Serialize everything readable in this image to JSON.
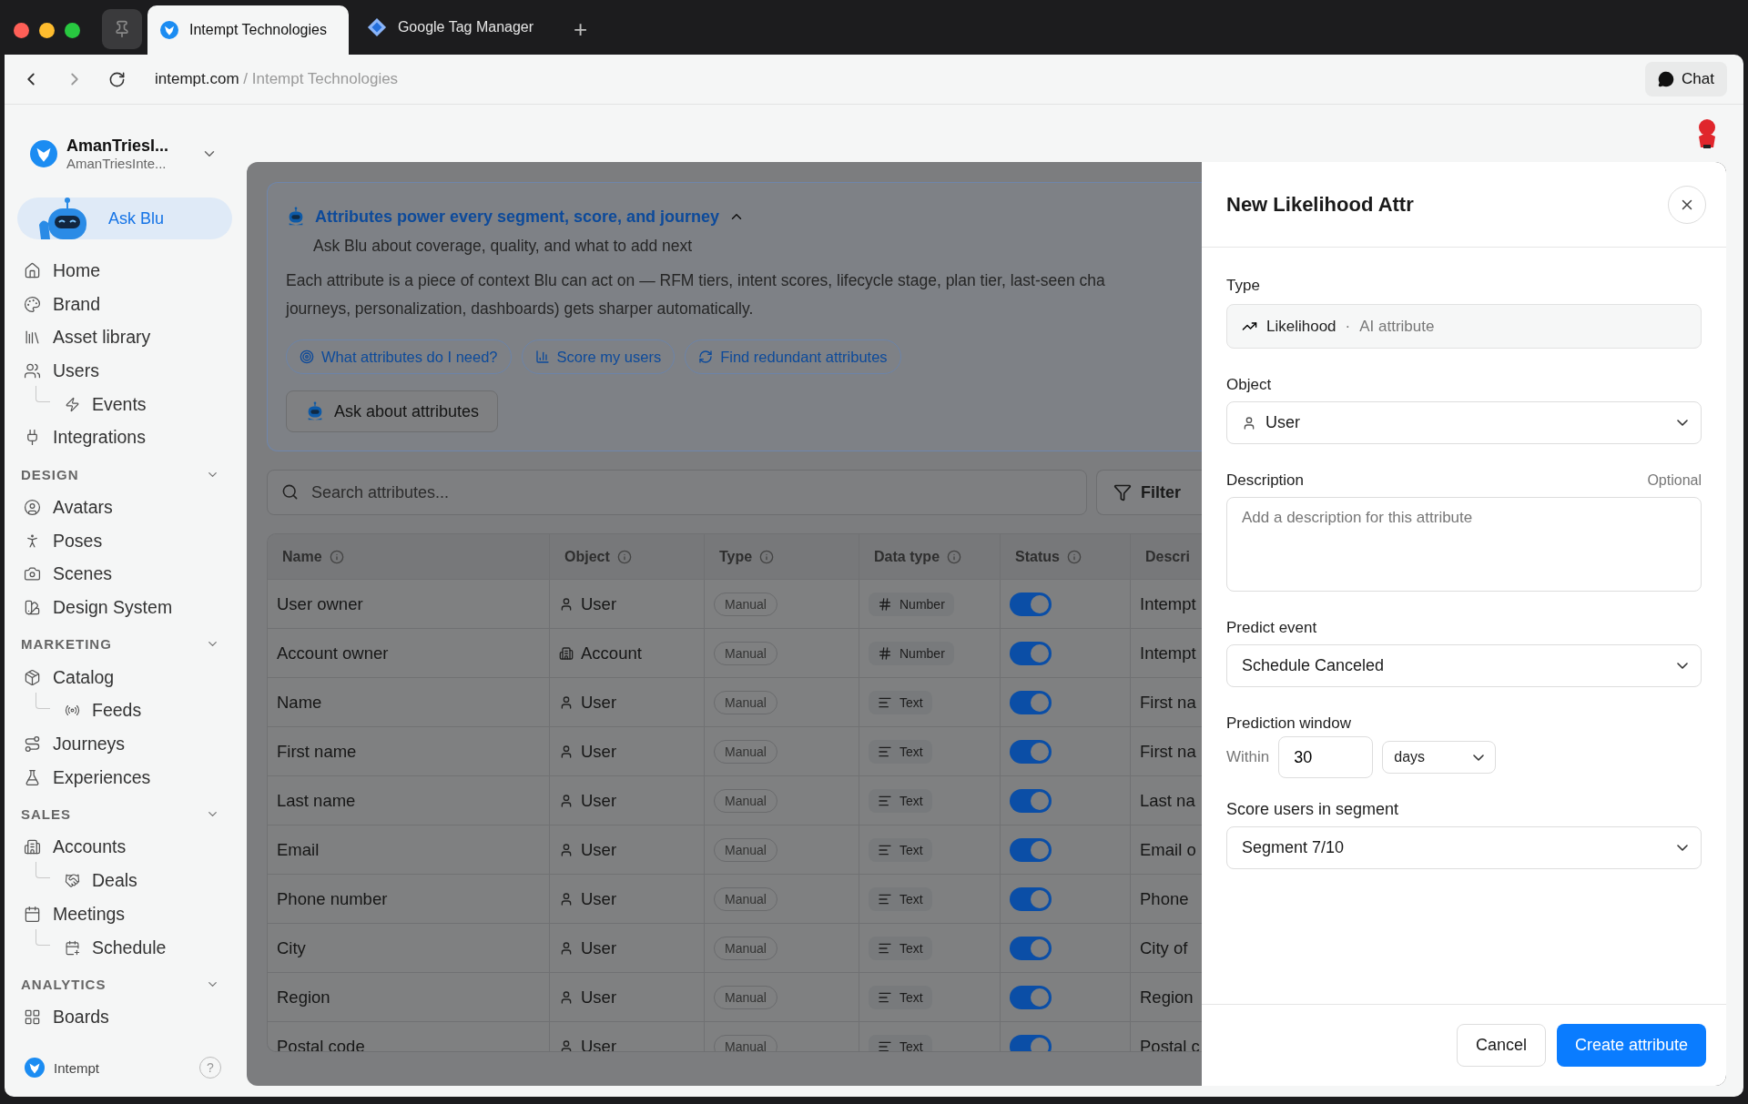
{
  "browser": {
    "tabs": [
      {
        "title": "Intempt Technologies",
        "selected": true,
        "kind": "intempt"
      },
      {
        "title": "Google Tag Manager",
        "selected": false,
        "kind": "gtm"
      }
    ],
    "new_tab": "+",
    "url": {
      "domain": "intempt.com",
      "path": " / Intempt Technologies"
    },
    "chat": "Chat"
  },
  "sidebar": {
    "workspace": {
      "name": "AmanTriesI...",
      "sub": "AmanTriesInte..."
    },
    "ask_blu": "Ask Blu",
    "groups": [
      {
        "items": [
          {
            "label": "Home"
          },
          {
            "label": "Brand"
          },
          {
            "label": "Asset library"
          },
          {
            "label": "Users",
            "children": [
              {
                "label": "Events"
              }
            ]
          },
          {
            "label": "Integrations"
          }
        ]
      },
      {
        "title": "DESIGN",
        "expanded": true,
        "items": [
          {
            "label": "Avatars"
          },
          {
            "label": "Poses"
          },
          {
            "label": "Scenes"
          },
          {
            "label": "Design System"
          }
        ]
      },
      {
        "title": "MARKETING",
        "expanded": true,
        "items": [
          {
            "label": "Catalog",
            "children": [
              {
                "label": "Feeds"
              }
            ]
          },
          {
            "label": "Journeys"
          },
          {
            "label": "Experiences"
          }
        ]
      },
      {
        "title": "SALES",
        "expanded": true,
        "items": [
          {
            "label": "Accounts",
            "children": [
              {
                "label": "Deals"
              }
            ]
          },
          {
            "label": "Meetings",
            "children": [
              {
                "label": "Schedule"
              }
            ]
          }
        ]
      },
      {
        "title": "ANALYTICS",
        "expanded": true,
        "items": [
          {
            "label": "Boards"
          }
        ]
      }
    ],
    "footer": {
      "brand": "Intempt",
      "help": "?"
    }
  },
  "banner": {
    "title": "Attributes power every segment, score, and journey",
    "expanded": true,
    "subtitle": "Ask Blu about coverage, quality, and what to add next",
    "text_lines": [
      "Each attribute is a piece of context Blu can act on — RFM tiers, intent scores, lifecycle stage, plan tier, last-seen cha",
      "journeys, personalization, dashboards) gets sharper automatically."
    ],
    "chips": [
      "What attributes do I need?",
      "Score my users",
      "Find redundant attributes"
    ],
    "ask_button": "Ask about attributes"
  },
  "search": {
    "placeholder": "Search attributes..."
  },
  "filter": "Filter",
  "table": {
    "columns": [
      {
        "label": "Name",
        "info": true
      },
      {
        "label": "Object",
        "info": true
      },
      {
        "label": "Type",
        "info": true
      },
      {
        "label": "Data type",
        "info": true
      },
      {
        "label": "Status",
        "info": true
      },
      {
        "label": "Descri",
        "info": false
      }
    ],
    "rows": [
      {
        "name": "User owner",
        "object": {
          "label": "User",
          "kind": "user"
        },
        "type": "Manual",
        "data_type": {
          "label": "Number",
          "kind": "number"
        },
        "on": true,
        "description": "Intempt"
      },
      {
        "name": "Account owner",
        "object": {
          "label": "Account",
          "kind": "account"
        },
        "type": "Manual",
        "data_type": {
          "label": "Number",
          "kind": "number"
        },
        "on": true,
        "description": "Intempt"
      },
      {
        "name": "Name",
        "object": {
          "label": "User",
          "kind": "user"
        },
        "type": "Manual",
        "data_type": {
          "label": "Text",
          "kind": "text"
        },
        "on": true,
        "description": "First na"
      },
      {
        "name": "First name",
        "object": {
          "label": "User",
          "kind": "user"
        },
        "type": "Manual",
        "data_type": {
          "label": "Text",
          "kind": "text"
        },
        "on": true,
        "description": "First na"
      },
      {
        "name": "Last name",
        "object": {
          "label": "User",
          "kind": "user"
        },
        "type": "Manual",
        "data_type": {
          "label": "Text",
          "kind": "text"
        },
        "on": true,
        "description": "Last na"
      },
      {
        "name": "Email",
        "object": {
          "label": "User",
          "kind": "user"
        },
        "type": "Manual",
        "data_type": {
          "label": "Text",
          "kind": "text"
        },
        "on": true,
        "description": "Email o"
      },
      {
        "name": "Phone number",
        "object": {
          "label": "User",
          "kind": "user"
        },
        "type": "Manual",
        "data_type": {
          "label": "Text",
          "kind": "text"
        },
        "on": true,
        "description": "Phone"
      },
      {
        "name": "City",
        "object": {
          "label": "User",
          "kind": "user"
        },
        "type": "Manual",
        "data_type": {
          "label": "Text",
          "kind": "text"
        },
        "on": true,
        "description": "City of"
      },
      {
        "name": "Region",
        "object": {
          "label": "User",
          "kind": "user"
        },
        "type": "Manual",
        "data_type": {
          "label": "Text",
          "kind": "text"
        },
        "on": true,
        "description": "Region"
      },
      {
        "name": "Postal code",
        "object": {
          "label": "User",
          "kind": "user"
        },
        "type": "Manual",
        "data_type": {
          "label": "Text",
          "kind": "text"
        },
        "on": true,
        "description": "Postal c"
      }
    ]
  },
  "panel": {
    "title": "New Likelihood Attr",
    "type": {
      "label": "Type",
      "value": "Likelihood",
      "separator": "·",
      "note": "AI attribute"
    },
    "object": {
      "label": "Object",
      "value": "User"
    },
    "description": {
      "label": "Description",
      "optional": "Optional",
      "placeholder": "Add a description for this attribute"
    },
    "predict_event": {
      "label": "Predict event",
      "value": "Schedule Canceled"
    },
    "prediction_window": {
      "label": "Prediction window",
      "prefix": "Within",
      "value": "30",
      "unit": "days"
    },
    "segment": {
      "label": "Score users in segment",
      "value": "Segment 7/10"
    },
    "cancel": "Cancel",
    "create": "Create attribute"
  }
}
